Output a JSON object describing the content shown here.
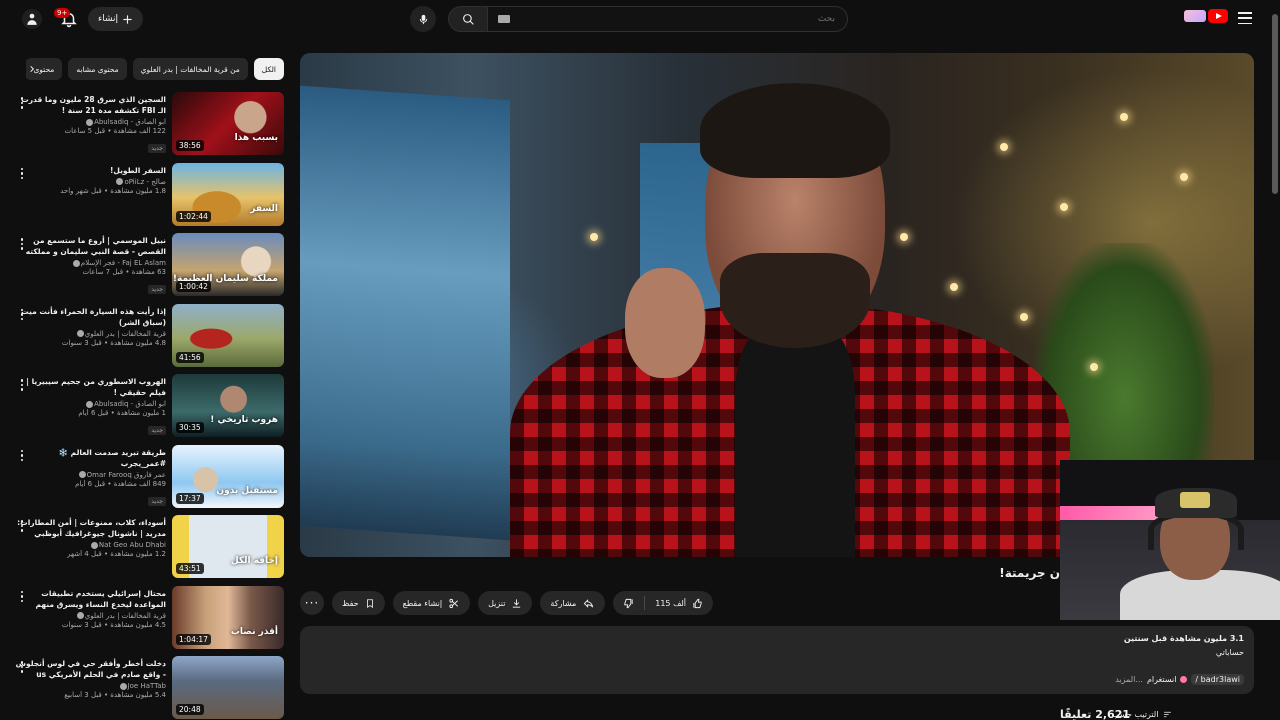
{
  "header": {
    "search_placeholder": "بحث",
    "create_label": "إنشاء",
    "notifications_badge": "9+",
    "logo_text": "Premium"
  },
  "video": {
    "title": "ن جريمتة!",
    "likes": "115 ألف",
    "actions": {
      "share": "مشاركة",
      "download": "تنزيل",
      "clip": "إنشاء مقطع",
      "save": "حفظ"
    }
  },
  "description": {
    "meta": "3.1 مليون مشاهدة  قبل سنتين",
    "line2": "حساباتي",
    "handle": "badr3lawi /",
    "instagram": "انستغرام",
    "more": "...المزيد"
  },
  "comments": {
    "count": "2,621 تعليقًا",
    "sort_label": "الترتيب حسب"
  },
  "chips": [
    {
      "label": "الكل",
      "active": true
    },
    {
      "label": "من قرية المخالفات | بدر العلوي",
      "active": false
    },
    {
      "label": "محتوى مشابه",
      "active": false
    },
    {
      "label": "محتوى",
      "active": false
    }
  ],
  "recommendations": [
    {
      "title": "السجين الذي سرق 28 مليون وما قدرت الـ FBI تكشفه مدة 21 سنة !",
      "channel": "ابو الصادق - Abulsadiq",
      "meta": "122 ألف مشاهدة • قبل 5 ساعات",
      "badge": "جديد",
      "duration": "38:56",
      "thumb_text": "بسبب هذا",
      "thumb_class": "t1"
    },
    {
      "title": "السفر الطويل!",
      "channel": "صالح - oPiiLz",
      "meta": "1.8 مليون مشاهدة • قبل شهر واحد",
      "badge": "",
      "duration": "1:02:44",
      "thumb_text": "السفر",
      "thumb_class": "t2"
    },
    {
      "title": "نبيل الموسمي | أروع ما ستسمع من القصص - قصة النبي سليمان و مملكته العظيمة!",
      "channel": "Faj EL Aslam - فجر الإسلام",
      "meta": "63 مشاهدة • قبل 7 ساعات",
      "badge": "جديد",
      "duration": "1:00:42",
      "thumb_text": "مملكة سليمان العظيمة!",
      "thumb_class": "t3"
    },
    {
      "title": "إذا رأيت هذه السيارة الحمراء فأنت ميت (سباق الشر)",
      "channel": "قرية المخالفات | بدر العلوي",
      "meta": "4.8 مليون مشاهدة • قبل 3 سنوات",
      "badge": "",
      "duration": "41:56",
      "thumb_text": "",
      "thumb_class": "t4"
    },
    {
      "title": "الهروب الاسطوري من جحيم سيبيريا | فيلم حقيقي !",
      "channel": "ابو الصادق - Abulsadiq",
      "meta": "1 مليون مشاهدة • قبل 6 أيام",
      "badge": "جديد",
      "duration": "30:35",
      "thumb_text": "هروب تاريخي !",
      "thumb_class": "t5"
    },
    {
      "title": "طريقة تبريد صدمت العالم ❄️ #عمر_يجرب",
      "channel": "عمر فاروق Omar Farooq",
      "meta": "849 ألف مشاهدة • قبل 6 أيام",
      "badge": "جديد",
      "duration": "17:37",
      "thumb_text": "مستقبل بدون",
      "thumb_class": "t6"
    },
    {
      "title": "أسوداء، كلاب، ممنوعات | أمن المطارات: مدريد | ناشونال جيوغرافيك أبوظبي",
      "channel": "Nat Geo Abu Dhabi",
      "meta": "1.2 مليون مشاهدة • قبل 4 أشهر",
      "badge": "",
      "duration": "43:51",
      "thumb_text": "إخافة الكل",
      "thumb_class": "t7"
    },
    {
      "title": "محتال إسرائيلي يستخدم تطبيقات المواعدة ليخدع النساء ويسرق منهم ملايين الدولارات",
      "channel": "قرية المخالفات | بدر العلوي",
      "meta": "4.5 مليون مشاهدة • قبل 3 سنوات",
      "badge": "",
      "duration": "1:04:17",
      "thumb_text": "أقذر نصاب",
      "thumb_class": "t8"
    },
    {
      "title": "دخلت أخطر وأفقر حي في لوس أنجلوس - واقع صادم في الحلم الأمريكي us",
      "channel": "Joe HaTTab",
      "meta": "5.4 مليون مشاهدة • قبل 3 أسابيع",
      "badge": "",
      "duration": "20:48",
      "thumb_text": "",
      "thumb_class": "t9"
    }
  ]
}
